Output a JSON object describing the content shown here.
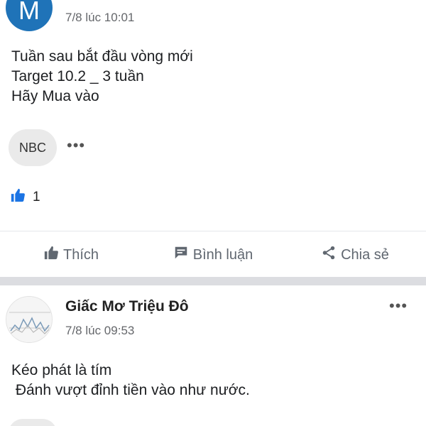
{
  "post1": {
    "avatar_letter": "M",
    "timestamp": "7/8 lúc 10:01",
    "lines": [
      "Tuần sau bắt đầu vòng mới",
      "Target 10.2 _ 3 tuần",
      "Hãy Mua vào"
    ],
    "tag": "NBC",
    "more": "•••",
    "like_count": "1"
  },
  "actions": {
    "like": "Thích",
    "comment": "Bình luận",
    "share": "Chia sẻ"
  },
  "post2": {
    "author": "Giấc Mơ Triệu Đô",
    "timestamp": "7/8 lúc 09:53",
    "lines": [
      "Kéo phát là tím",
      " Đánh vượt đỉnh tiền vào như nước."
    ],
    "more": "•••"
  },
  "colors": {
    "avatar_blue": "#1f73b8",
    "like_blue": "#1b74e4",
    "muted": "#65676b"
  }
}
